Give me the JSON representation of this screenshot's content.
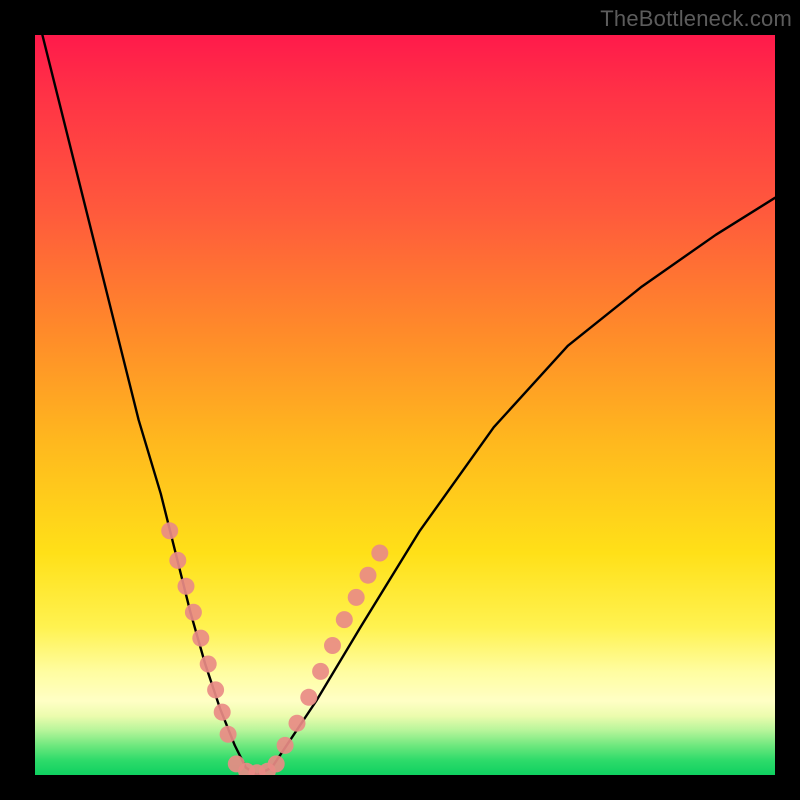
{
  "watermark": "TheBottleneck.com",
  "chart_data": {
    "type": "line",
    "title": "",
    "xlabel": "",
    "ylabel": "",
    "xlim": [
      0,
      100
    ],
    "ylim": [
      0,
      100
    ],
    "series": [
      {
        "name": "bottleneck-curve",
        "x": [
          1,
          3,
          5,
          8,
          11,
          14,
          17,
          19,
          21,
          23,
          25,
          27,
          28.5,
          30,
          32,
          34,
          38,
          44,
          52,
          62,
          72,
          82,
          92,
          100
        ],
        "y": [
          100,
          92,
          84,
          72,
          60,
          48,
          38,
          30,
          22,
          15,
          9,
          4,
          1,
          0,
          1,
          4,
          10,
          20,
          33,
          47,
          58,
          66,
          73,
          78
        ]
      }
    ],
    "markers": {
      "name": "highlight-dots",
      "left_branch": {
        "x": [
          18.2,
          19.3,
          20.4,
          21.4,
          22.4,
          23.4,
          24.4,
          25.3,
          26.1
        ],
        "y": [
          33,
          29,
          25.5,
          22,
          18.5,
          15,
          11.5,
          8.5,
          5.5
        ]
      },
      "right_branch": {
        "x": [
          33.8,
          35.4,
          37.0,
          38.6,
          40.2,
          41.8,
          43.4,
          45.0,
          46.6
        ],
        "y": [
          4,
          7,
          10.5,
          14,
          17.5,
          21,
          24,
          27,
          30
        ]
      },
      "bottom": {
        "x": [
          27.2,
          28.6,
          30.0,
          31.4,
          32.6
        ],
        "y": [
          1.5,
          0.5,
          0.3,
          0.5,
          1.5
        ]
      }
    },
    "gradient_stops": [
      {
        "pos": 0.0,
        "color": "#ff1a4b"
      },
      {
        "pos": 0.4,
        "color": "#ff8a2a"
      },
      {
        "pos": 0.7,
        "color": "#ffe018"
      },
      {
        "pos": 0.9,
        "color": "#ffffc5"
      },
      {
        "pos": 1.0,
        "color": "#0fd060"
      }
    ]
  }
}
